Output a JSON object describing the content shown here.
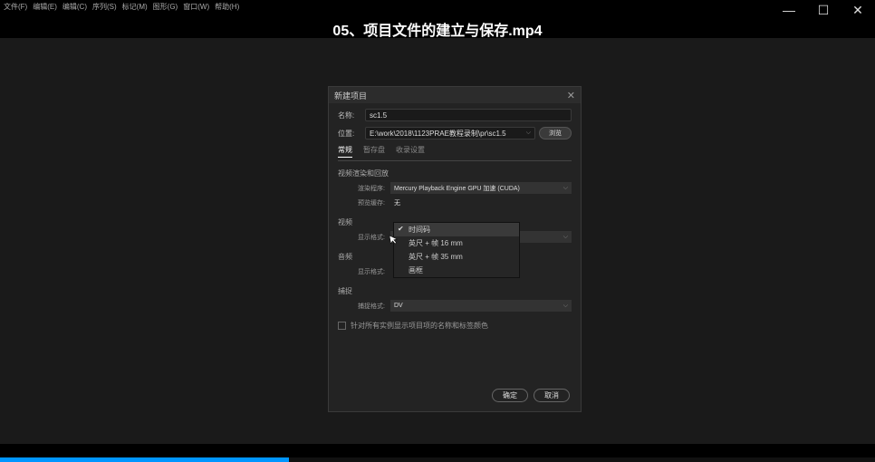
{
  "menubar": [
    "文件(F)",
    "编辑(E)",
    "编辑(C)",
    "序列(S)",
    "标记(M)",
    "图形(G)",
    "窗口(W)",
    "帮助(H)"
  ],
  "header": {
    "title": "05、项目文件的建立与保存.mp4"
  },
  "dialog": {
    "title": "新建项目",
    "name_label": "名称:",
    "name_value": "sc1.5",
    "location_label": "位置:",
    "location_value": "E:\\work\\2018\\1123PRAE教程录制\\pr\\sc1.5",
    "browse_label": "浏览",
    "tabs": {
      "general": "常规",
      "scratch": "暂存盘",
      "ingest": "收录设置"
    },
    "render_section": "视频渲染和回放",
    "renderer_label": "渲染程序:",
    "renderer_value": "Mercury Playback Engine GPU 加速 (CUDA)",
    "preview_cache_label": "预览缓存:",
    "preview_cache_value": "无",
    "video_section": "视频",
    "display_format_label": "显示格式:",
    "display_format_value": "时间码",
    "audio_section": "音频",
    "audio_display_label": "显示格式:",
    "capture_section": "捕捉",
    "capture_format_label": "捕捉格式:",
    "capture_format_value": "DV",
    "show_name_checkbox": "针对所有实例显示项目项的名称和标签颜色",
    "dropdown": {
      "opt1": "时间码",
      "opt2": "英尺 + 帧 16 mm",
      "opt3": "英尺 + 帧 35 mm",
      "opt4": "画框"
    },
    "ok": "确定",
    "cancel": "取消"
  }
}
